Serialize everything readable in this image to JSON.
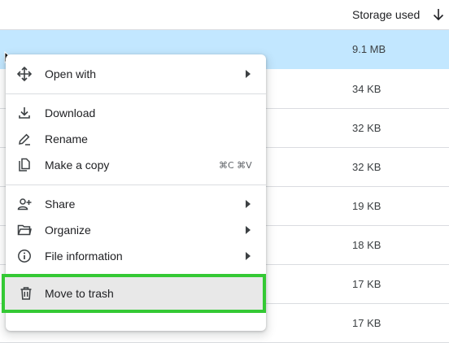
{
  "list": {
    "column_header": "Storage used",
    "sizes": [
      "9.1 MB",
      "34 KB",
      "32 KB",
      "32 KB",
      "19 KB",
      "18 KB",
      "17 KB",
      "17 KB"
    ]
  },
  "menu": {
    "open_with": "Open with",
    "download": "Download",
    "rename": "Rename",
    "make_a_copy": "Make a copy",
    "make_a_copy_shortcut": "⌘C ⌘V",
    "share": "Share",
    "organize": "Organize",
    "file_information": "File information",
    "move_to_trash": "Move to trash"
  },
  "colors": {
    "selected_row": "#c2e7ff",
    "highlight_border": "#34c934"
  }
}
